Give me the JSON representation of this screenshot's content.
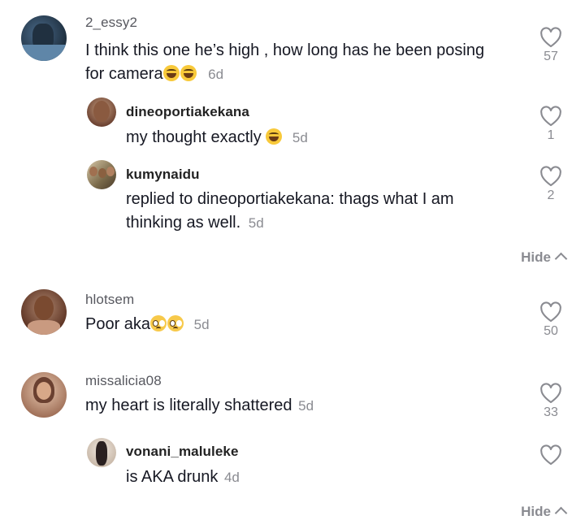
{
  "comments": [
    {
      "username": "2_essy2",
      "text_line1": "I think this one he’s high , how long has he been posing",
      "text_line2": "for camera",
      "time": "6d",
      "likes": "57",
      "emoji": "grinning-squinting-face",
      "replies": [
        {
          "username": "dineoportiakekana",
          "text": "my thought exactly",
          "time": "5d",
          "likes": "1",
          "emoji": "grinning-squinting-face"
        },
        {
          "username": "kumynaidu",
          "text_line1": "replied to dineoportiakekana: thags what I am",
          "text_line2": "thinking as well.",
          "time": "5d",
          "likes": "2"
        }
      ],
      "hide_label": "Hide"
    },
    {
      "username": "hlotsem",
      "text": "Poor aka",
      "time": "5d",
      "likes": "50",
      "emoji": "pleading-face"
    },
    {
      "username": "missalicia08",
      "text": "my heart is literally shattered",
      "time": "5d",
      "likes": "33",
      "replies": [
        {
          "username": "vonani_maluleke",
          "text": "is AKA drunk",
          "time": "4d",
          "likes": ""
        }
      ],
      "hide_label": "Hide"
    }
  ],
  "colors": {
    "text": "#161823",
    "muted": "#8a8b91",
    "username": "#57585f"
  },
  "icons": {
    "like": "heart-outline-icon",
    "hide": "chevron-up-icon"
  }
}
